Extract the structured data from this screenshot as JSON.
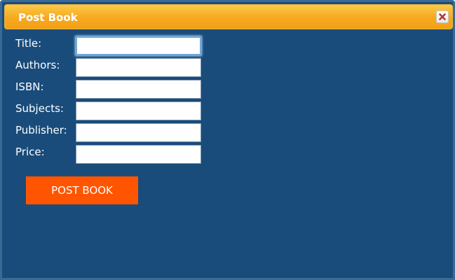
{
  "dialog": {
    "title": "Post Book",
    "close_icon": "close-icon"
  },
  "form": {
    "fields": [
      {
        "label": "Title:",
        "value": "",
        "focused": true
      },
      {
        "label": "Authors:",
        "value": ""
      },
      {
        "label": "ISBN:",
        "value": ""
      },
      {
        "label": "Subjects:",
        "value": ""
      },
      {
        "label": "Publisher:",
        "value": ""
      },
      {
        "label": "Price:",
        "value": ""
      }
    ],
    "submit_label": "POST BOOK"
  },
  "colors": {
    "dialog_background": "#194c7b",
    "titlebar": "#f7a91e",
    "submit_button": "#ff5500",
    "label_text": "#ffffff"
  }
}
